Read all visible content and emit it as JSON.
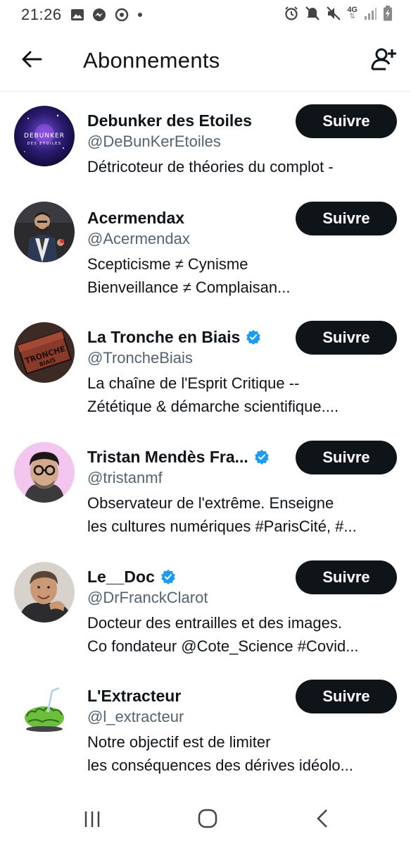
{
  "status_bar": {
    "time": "21:26",
    "network": "4G",
    "left_icons": [
      "image-icon",
      "messenger-icon",
      "sync-icon",
      "dot-icon"
    ],
    "right_icons": [
      "alarm-icon",
      "mute-icon",
      "volume-off-icon",
      "network-4g-icon",
      "signal-icon",
      "battery-icon"
    ]
  },
  "header": {
    "title": "Abonnements",
    "back_icon": "arrow-left-icon",
    "add_icon": "add-user-icon"
  },
  "users": [
    {
      "name": "Debunker des Etoiles",
      "handle": "@DeBunKerEtoiles",
      "verified": false,
      "bio_lines": [
        "Détricoteur de théories du complot -",
        ""
      ],
      "avatar_text": "DEBUNKER\nDES ETOILES",
      "follow_label": "Suivre"
    },
    {
      "name": "Acermendax",
      "handle": "@Acermendax",
      "verified": false,
      "bio_lines": [
        "Scepticisme ≠ Cynisme",
        "Bienveillance ≠ Complaisan..."
      ],
      "follow_label": "Suivre"
    },
    {
      "name": "La Tronche en Biais",
      "handle": "@TroncheBiais",
      "verified": true,
      "bio_lines": [
        "La chaîne de l'Esprit Critique --",
        "Zététique & démarche scientifique...."
      ],
      "avatar_text": "TRONCHE BIAIS",
      "follow_label": "Suivre"
    },
    {
      "name": "Tristan Mendès Fra...",
      "handle": "@tristanmf",
      "verified": true,
      "bio_lines": [
        "Observateur de l'extrême. Enseigne",
        "les cultures numériques #ParisCité, #..."
      ],
      "follow_label": "Suivre"
    },
    {
      "name": "Le__Doc",
      "handle": "@DrFranckClarot",
      "verified": true,
      "bio_lines": [
        "Docteur des entrailles et des images.",
        "Co fondateur @Cote_Science #Covid..."
      ],
      "follow_label": "Suivre"
    },
    {
      "name": "L'Extracteur",
      "handle": "@l_extracteur",
      "verified": false,
      "bio_lines": [
        "Notre objectif est de limiter",
        "les conséquences des dérives idéolo..."
      ],
      "follow_label": "Suivre"
    }
  ],
  "colors": {
    "button_bg": "#0f1419",
    "button_text": "#ffffff",
    "handle": "#536471",
    "verified": "#1d9bf0"
  },
  "nav_bar": {
    "items": [
      "recent-apps-icon",
      "home-icon",
      "back-icon"
    ]
  }
}
